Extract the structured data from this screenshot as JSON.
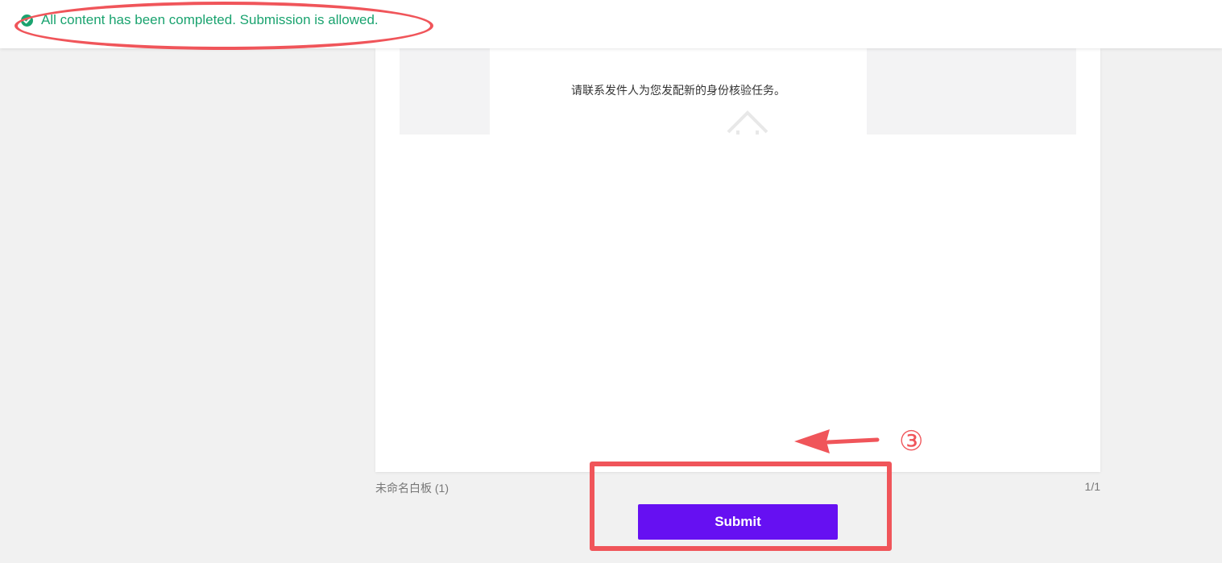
{
  "status_bar": {
    "message": "All content has been completed. Submission is allowed.",
    "icon": "check-circle-icon",
    "color": "#1aa36f"
  },
  "document": {
    "preview_message": "请联系发件人为您发配新的身份核验任务。",
    "preview_icon": "home-icon",
    "name": "未命名白板 (1)",
    "page_indicator": "1/1"
  },
  "actions": {
    "submit_label": "Submit",
    "submit_color": "#6610f2"
  },
  "annotations": {
    "step_label": "③",
    "color": "#f0555a"
  }
}
